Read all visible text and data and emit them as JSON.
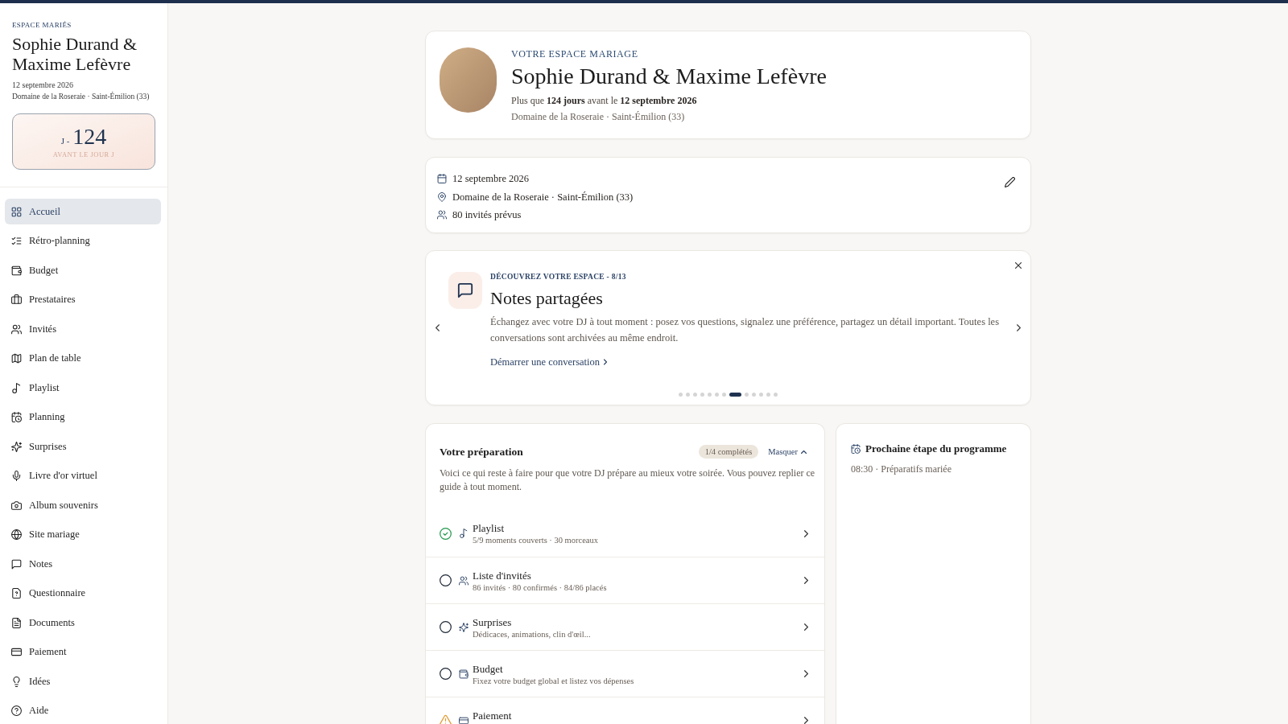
{
  "sidebar": {
    "eyebrow": "ESPACE MARIÉS",
    "couple": "Sophie Durand & Maxime Lefèvre",
    "date": "12 septembre 2026",
    "venue": "Domaine de la Roseraie · Saint-Émilion (33)",
    "countdown": {
      "prefix": "J -",
      "value": "124",
      "caption": "AVANT LE JOUR J"
    },
    "items": [
      {
        "label": "Accueil",
        "selected": true
      },
      {
        "label": "Rétro-planning",
        "selected": false
      },
      {
        "label": "Budget",
        "selected": false
      },
      {
        "label": "Prestataires",
        "selected": false
      },
      {
        "label": "Invités",
        "selected": false
      },
      {
        "label": "Plan de table",
        "selected": false
      },
      {
        "label": "Playlist",
        "selected": false
      },
      {
        "label": "Planning",
        "selected": false
      },
      {
        "label": "Surprises",
        "selected": false
      },
      {
        "label": "Livre d'or virtuel",
        "selected": false
      },
      {
        "label": "Album souvenirs",
        "selected": false
      },
      {
        "label": "Site mariage",
        "selected": false
      },
      {
        "label": "Notes",
        "selected": false
      },
      {
        "label": "Questionnaire",
        "selected": false
      },
      {
        "label": "Documents",
        "selected": false
      },
      {
        "label": "Paiement",
        "selected": false
      },
      {
        "label": "Idées",
        "selected": false
      },
      {
        "label": "Aide",
        "selected": false
      }
    ]
  },
  "header_card": {
    "eyebrow": "VOTRE ESPACE MARIAGE",
    "title": "Sophie Durand & Maxime Lefèvre",
    "summary": "Plus que **124 jours** avant le **12 septembre 2026**",
    "venue": "Domaine de la Roseraie · Saint-Émilion (33)"
  },
  "details_card": {
    "lines": [
      "12 septembre 2026",
      "Domaine de la Roseraie · Saint-Émilion (33)",
      "80 invités prévus"
    ]
  },
  "discover_card": {
    "eyebrow": "DÉCOUVREZ VOTRE ESPACE - 8/13",
    "title": "Notes partagées",
    "body": "Échangez avec votre DJ à tout moment : posez vos questions, signalez une préférence, partagez un détail important. Toutes les conversations sont archivées au même endroit.",
    "link": "Démarrer une conversation",
    "pages": [
      {
        "selected": false
      },
      {
        "selected": false
      },
      {
        "selected": false
      },
      {
        "selected": false
      },
      {
        "selected": false
      },
      {
        "selected": false
      },
      {
        "selected": false
      },
      {
        "selected": true
      },
      {
        "selected": false
      },
      {
        "selected": false
      },
      {
        "selected": false
      },
      {
        "selected": false
      },
      {
        "selected": false
      }
    ]
  },
  "preparation": {
    "title": "Votre préparation",
    "badge": "1/4 complétés",
    "toggle": "Masquer",
    "description": "Voici ce qui reste à faire pour que votre DJ prépare au mieux votre soirée. Vous pouvez replier ce guide à tout moment.",
    "items": [
      {
        "title": "Playlist",
        "subtitle": "5/9 moments couverts · 30 morceaux",
        "kind": "done"
      },
      {
        "title": "Liste d'invités",
        "subtitle": "86 invités · 80 confirmés · 84/86 placés",
        "kind": "pending"
      },
      {
        "title": "Surprises",
        "subtitle": "Dédicaces, animations, clin d'œil...",
        "kind": "pending"
      },
      {
        "title": "Budget",
        "subtitle": "Fixez votre budget global et listez vos dépenses",
        "kind": "pending"
      },
      {
        "title": "Paiement",
        "kind": "warning"
      }
    ]
  },
  "next_step": {
    "title": "Prochaine étape du programme",
    "text": "08:30 · Préparatifs mariée"
  }
}
